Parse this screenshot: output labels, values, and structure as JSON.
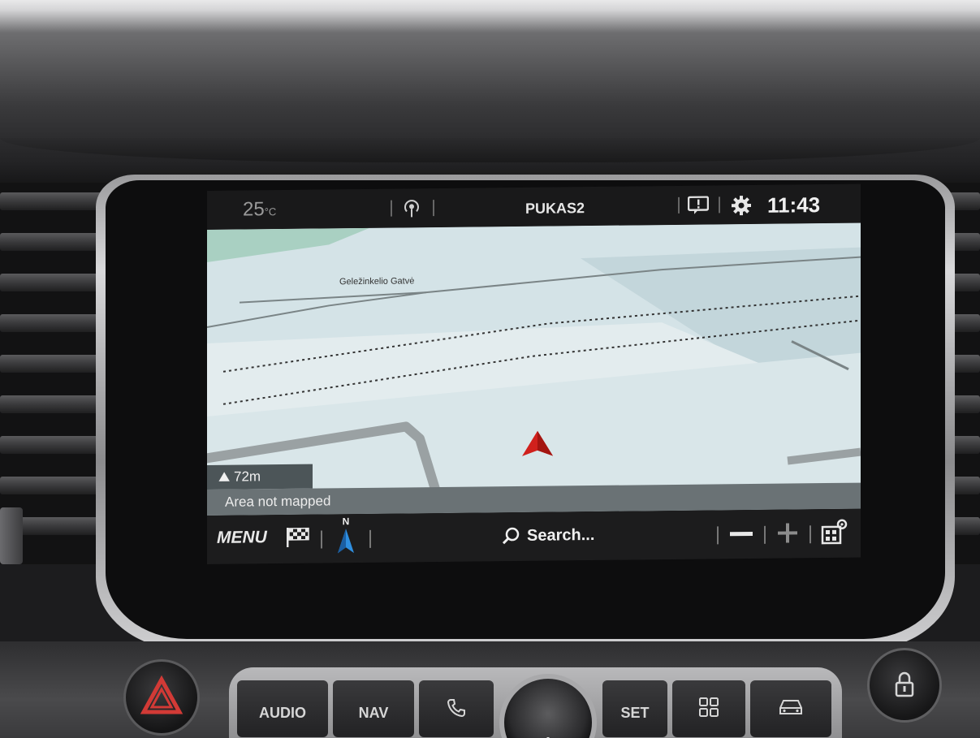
{
  "status_bar": {
    "temperature": "25",
    "temperature_unit": "°C",
    "device_name": "PUKAS2",
    "time": "11:43",
    "icons": [
      "gps-signal-icon",
      "message-icon",
      "settings-gear-icon"
    ]
  },
  "map": {
    "street_name": "Geležinkelio Gatvė",
    "position_marker": "vehicle-position-arrow-icon",
    "altitude": "72m",
    "area_status": "Area not mapped"
  },
  "bottom_bar": {
    "menu_label": "MENU",
    "compass_letter": "N",
    "search_label": "Search...",
    "icons": [
      "destination-flag-icon",
      "compass-icon",
      "search-icon",
      "zoom-out-icon",
      "zoom-in-icon",
      "map-view-icon"
    ]
  },
  "console_buttons": {
    "audio": "AUDIO",
    "nav": "NAV",
    "set": "SET",
    "icons": [
      "hazard-icon",
      "phone-icon",
      "power-icon",
      "apps-grid-icon",
      "car-icon",
      "lock-icon"
    ]
  },
  "colors": {
    "map_background": "#d2e2e6",
    "accent_marker": "#d0201c",
    "compass_arrow": "#2f8fe0",
    "status_bar_bg": "#19191a"
  }
}
